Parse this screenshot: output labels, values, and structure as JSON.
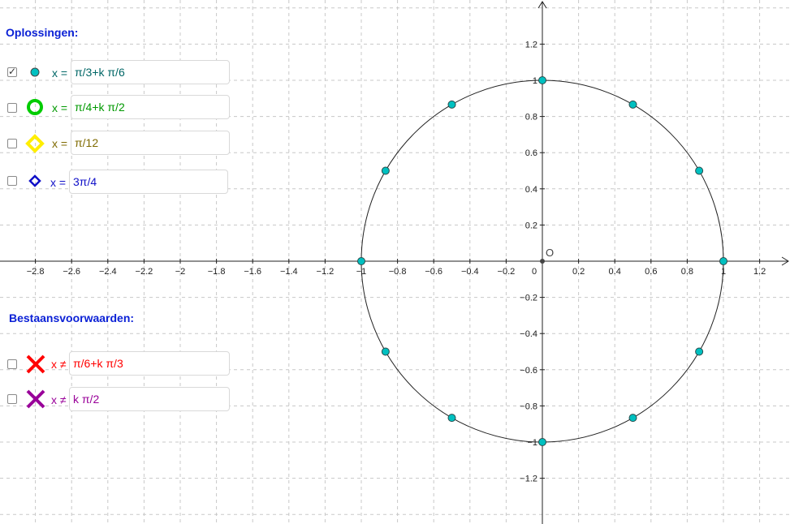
{
  "headings": {
    "solutions": "Oplossingen:",
    "conditions": "Bestaansvoorwaarden:"
  },
  "solutions": [
    {
      "checked": true,
      "icon": "filled-dot-icon",
      "color": "#006666",
      "prefix": "x =",
      "value": "π/3+k π/6"
    },
    {
      "checked": false,
      "icon": "green-ring-icon",
      "color": "#009900",
      "prefix": "x =",
      "value": "π/4+k π/2"
    },
    {
      "checked": false,
      "icon": "yellow-diamond-icon",
      "color": "#7f6a00",
      "prefix": "x =",
      "value": " π/12"
    },
    {
      "checked": false,
      "icon": "blue-diamond-icon",
      "color": "#1010c8",
      "prefix": "x =",
      "value": "3π/4"
    }
  ],
  "conditions": [
    {
      "checked": false,
      "icon": "red-cross-icon",
      "color": "#ff0000",
      "prefix": "x ≠",
      "value": " π/6+k π/3"
    },
    {
      "checked": false,
      "icon": "purple-cross-icon",
      "color": "#990099",
      "prefix": "x ≠",
      "value": "k π/2"
    }
  ],
  "graph": {
    "origin_label": "O",
    "x_ticks": [
      "−2.8",
      "−2.6",
      "−2.4",
      "−2.2",
      "−2",
      "−1.8",
      "−1.6",
      "−1.4",
      "−1.2",
      "−1",
      "−0.8",
      "−0.6",
      "−0.4",
      "−0.2",
      "0",
      "0.2",
      "0.4",
      "0.6",
      "0.8",
      "1",
      "1.2"
    ],
    "y_ticks": [
      "1.2",
      "1",
      "0.8",
      "0.6",
      "0.4",
      "0.2",
      "−0.2",
      "−0.4",
      "−0.6",
      "−0.8",
      "−1",
      "−1.2"
    ],
    "circle_radius": 1,
    "point_color": "#00c0c0",
    "points_deg": [
      0,
      30,
      60,
      90,
      120,
      150,
      180,
      210,
      240,
      270,
      300,
      330
    ]
  }
}
